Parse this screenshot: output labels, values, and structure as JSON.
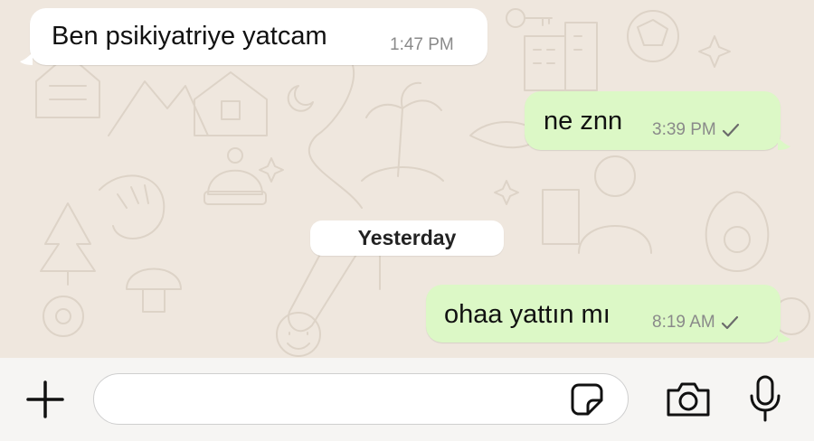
{
  "colors": {
    "wallpaper": "#efe7de",
    "incoming_bubble": "#ffffff",
    "outgoing_bubble": "#dcf8c6",
    "timestamp": "#8a8a8a"
  },
  "messages": [
    {
      "direction": "incoming",
      "text": "Ben psikiyatriye yatcam",
      "time": "1:47 PM"
    },
    {
      "direction": "outgoing",
      "text": "ne znn",
      "time": "3:39 PM",
      "status": "sent-check-icon"
    },
    {
      "direction": "outgoing",
      "text": "ohaa yattın mı",
      "time": "8:19 AM",
      "status": "sent-check-icon"
    }
  ],
  "date_separator": "Yesterday",
  "input_bar": {
    "attach_icon": "plus-icon",
    "message_placeholder": "",
    "sticker_icon": "sticker-icon",
    "camera_icon": "camera-icon",
    "mic_icon": "microphone-icon"
  }
}
